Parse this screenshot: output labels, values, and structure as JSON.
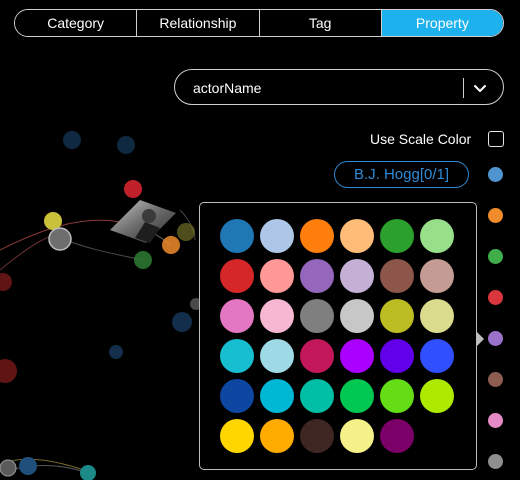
{
  "tabs": [
    {
      "label": "Category",
      "active": false
    },
    {
      "label": "Relationship",
      "active": false
    },
    {
      "label": "Tag",
      "active": false
    },
    {
      "label": "Property",
      "active": true
    }
  ],
  "property_select": {
    "value": "actorName"
  },
  "scale_color": {
    "label": "Use Scale Color",
    "checked": false
  },
  "selected_value": {
    "label": "B.J. Hogg[0/1]",
    "color": "#3a8fd6"
  },
  "side_swatches": [
    "#4f93cf",
    "#f08c2c",
    "#3fae4a",
    "#d9363e",
    "#9a72c9",
    "#8e5d52",
    "#e58ac4",
    "#8f8f8f"
  ],
  "palette": [
    "#1f77b4",
    "#aec7e8",
    "#ff7f0e",
    "#ffbb78",
    "#2ca02c",
    "#98df8a",
    "#d62728",
    "#ff9896",
    "#9467bd",
    "#c5b0d5",
    "#8c564b",
    "#c49c94",
    "#e377c2",
    "#f7b6d2",
    "#7f7f7f",
    "#c7c7c7",
    "#bcbd22",
    "#dbdb8d",
    "#17becf",
    "#9edae5",
    "#c2185b",
    "#aa00ff",
    "#6200ea",
    "#304ffe",
    "#0d47a1",
    "#00b8d4",
    "#00bfa5",
    "#00c853",
    "#64dd17",
    "#aeea00",
    "#ffd600",
    "#ffab00",
    "#3e2723",
    "#f4f189",
    "#7b0068"
  ]
}
